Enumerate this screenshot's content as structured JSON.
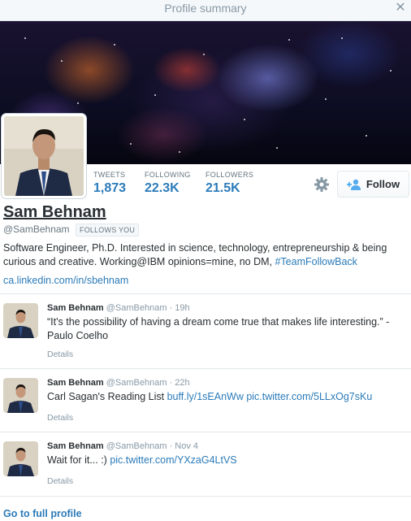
{
  "window": {
    "title": "Profile summary",
    "close_icon": "close-icon"
  },
  "profile": {
    "name": "Sam Behnam",
    "handle": "@SamBehnam",
    "follows_you": "FOLLOWS YOU",
    "bio": "Software Engineer, Ph.D. Interested in science, technology, entrepreneurship & being curious and creative. Working@IBM opinions=mine, no DM, ",
    "bio_hashtag": "#TeamFollowBack",
    "website": "ca.linkedin.com/in/sbehnam",
    "stats": [
      {
        "label": "TWEETS",
        "value": "1,873"
      },
      {
        "label": "FOLLOWING",
        "value": "22.3K"
      },
      {
        "label": "FOLLOWERS",
        "value": "21.5K"
      }
    ],
    "follow_label": "Follow",
    "settings_icon": "gear-icon"
  },
  "tweets": [
    {
      "author": "Sam Behnam",
      "meta": " @SamBehnam · 19h",
      "text": "“It's the possibility of having a dream come true that makes life interesting.” - Paulo Coelho",
      "url": "",
      "details": "Details"
    },
    {
      "author": "Sam Behnam",
      "meta": " @SamBehnam · 22h",
      "text": "Carl Sagan's Reading List ",
      "url": "buff.ly/1sEAnWw pic.twitter.com/5LLxOg7sKu",
      "details": "Details"
    },
    {
      "author": "Sam Behnam",
      "meta": " @SamBehnam · Nov 4",
      "text": "Wait for it... :) ",
      "url": "pic.twitter.com/YXzaG4LtVS",
      "details": "Details"
    }
  ],
  "footer": {
    "go_full": "Go to full profile"
  },
  "colors": {
    "link": "#2b7bb9",
    "muted": "#8899a6",
    "text": "#292f33"
  }
}
